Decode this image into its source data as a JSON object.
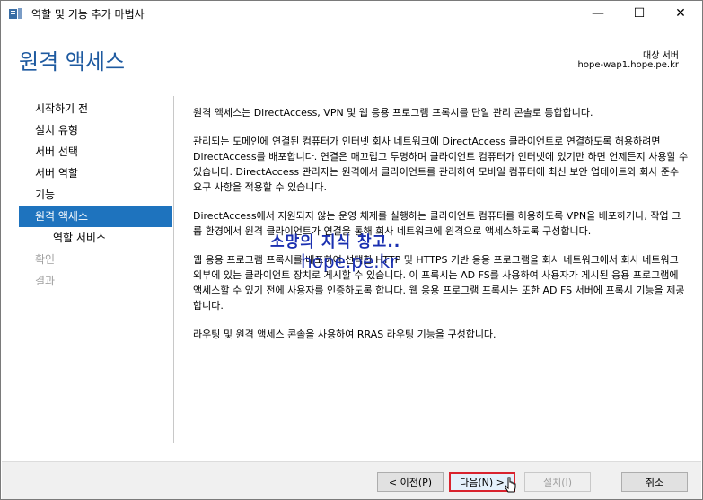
{
  "window": {
    "title": "역할 및 기능 추가 마법사",
    "controls": {
      "minimize": "—",
      "maximize": "☐",
      "close": "✕"
    }
  },
  "header": {
    "title": "원격 액세스",
    "target_label": "대상 서버",
    "target_host": "hope-wap1.hope.pe.kr"
  },
  "nav": {
    "items": [
      {
        "label": "시작하기 전"
      },
      {
        "label": "설치 유형"
      },
      {
        "label": "서버 선택"
      },
      {
        "label": "서버 역할"
      },
      {
        "label": "기능"
      },
      {
        "label": "원격 액세스"
      },
      {
        "label": "역할 서비스"
      },
      {
        "label": "확인"
      },
      {
        "label": "결과"
      }
    ]
  },
  "content": {
    "paragraphs": [
      "원격 액세스는 DirectAccess, VPN 및 웹 응용 프로그램 프록시를 단일 관리 콘솔로 통합합니다.",
      "관리되는 도메인에 연결된 컴퓨터가 인터넷 회사 네트워크에 DirectAccess 클라이언트로 연결하도록 허용하려면 DirectAccess를 배포합니다. 연결은 매끄럽고 투명하며 클라이언트 컴퓨터가 인터넷에 있기만 하면 언제든지 사용할 수 있습니다. DirectAccess 관리자는 원격에서 클라이언트를 관리하여 모바일 컴퓨터에 최신 보안 업데이트와 회사 준수 요구 사항을 적용할 수 있습니다.",
      "DirectAccess에서 지원되지 않는 운영 체제를 실행하는 클라이언트 컴퓨터를 허용하도록 VPN을 배포하거나, 작업 그룹 환경에서 원격 클라이언트가 연결을 통해 회사 네트워크에 원격으로 액세스하도록 구성합니다.",
      "웹 응용 프로그램 프록시를 배포하여 선택한 HTTP 및 HTTPS 기반 응용 프로그램을 회사 네트워크에서 회사 네트워크 외부에 있는 클라이언트 장치로 게시할 수 있습니다. 이 프록시는 AD FS를 사용하여 사용자가 게시된 응용 프로그램에 액세스할 수 있기 전에 사용자를 인증하도록 합니다. 웹 응용 프로그램 프록시는 또한 AD FS 서버에 프록시 기능을 제공합니다.",
      "라우팅 및 원격 액세스 콘솔을 사용하여 RRAS 라우팅 기능을 구성합니다."
    ],
    "watermark_line1": "소망의 지식 창고..",
    "watermark_line2": "hope.pe.kr"
  },
  "footer": {
    "prev_label": "< 이전(P)",
    "next_label": "다음(N) >",
    "install_label": "설치(I)",
    "cancel_label": "취소"
  }
}
